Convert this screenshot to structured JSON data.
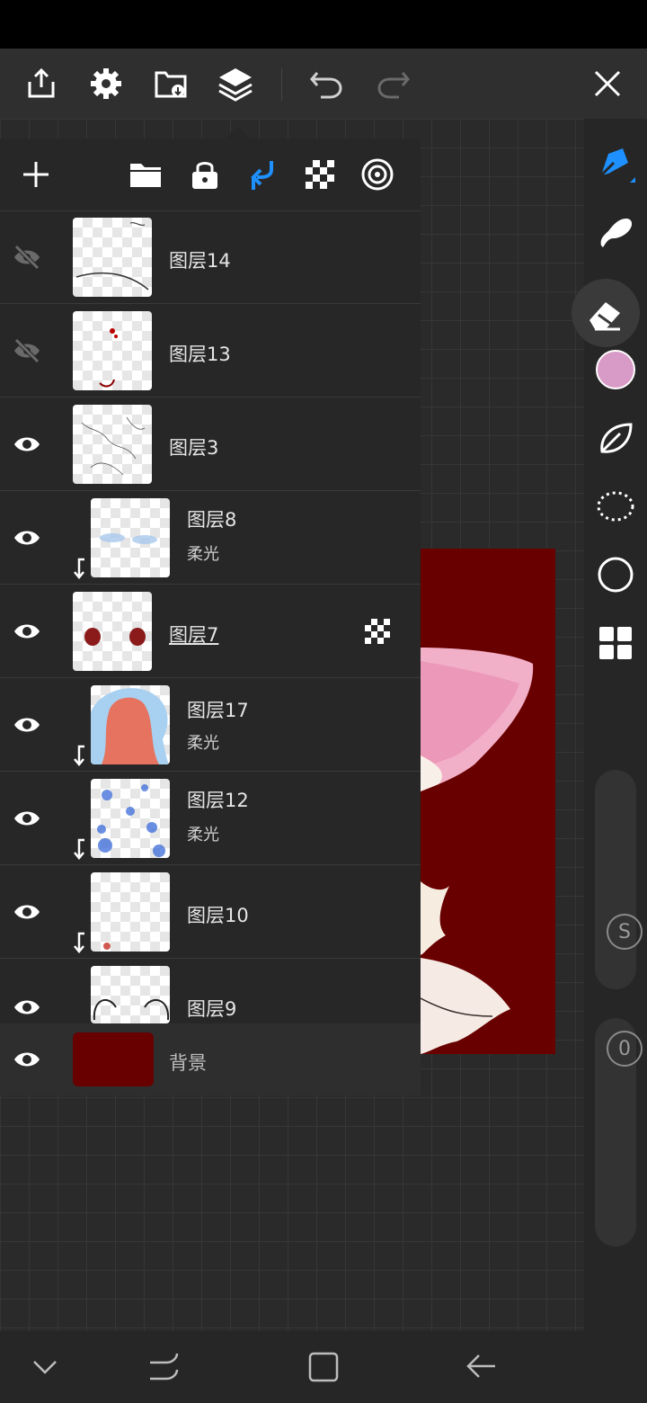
{
  "app": {
    "toolbar": {
      "icons": [
        "share-icon",
        "settings-icon",
        "import-icon",
        "layers-icon",
        "undo-icon",
        "redo-icon",
        "close-icon"
      ]
    },
    "layers_toolbar": {
      "icons": [
        "add-icon",
        "folder-icon",
        "lock-icon",
        "clip-icon",
        "alpha-icon",
        "blend-icon"
      ]
    },
    "layers": [
      {
        "name": "图层14",
        "visible": false,
        "clipped": false,
        "blend": ""
      },
      {
        "name": "图层13",
        "visible": false,
        "clipped": false,
        "blend": ""
      },
      {
        "name": "图层3",
        "visible": true,
        "clipped": false,
        "blend": ""
      },
      {
        "name": "图层8",
        "visible": true,
        "clipped": true,
        "blend": "柔光"
      },
      {
        "name": "图层7",
        "visible": true,
        "clipped": false,
        "blend": "",
        "selected": true,
        "alpha_lock": true
      },
      {
        "name": "图层17",
        "visible": true,
        "clipped": true,
        "blend": "柔光"
      },
      {
        "name": "图层12",
        "visible": true,
        "clipped": true,
        "blend": "柔光"
      },
      {
        "name": "图层10",
        "visible": true,
        "clipped": true,
        "blend": ""
      },
      {
        "name": "图层9",
        "visible": true,
        "clipped": false,
        "blend": ""
      }
    ],
    "background_layer": {
      "name": "背景",
      "visible": true,
      "color": "#690000"
    },
    "right_tools": {
      "icons": [
        "pen-icon",
        "smudge-icon",
        "eraser-icon",
        "color-swatch",
        "leaf-icon",
        "lasso-icon",
        "circle-icon",
        "grid-icon"
      ],
      "current_color": "#d89ac6",
      "size_label": "S",
      "opacity_label": "0"
    },
    "colors": {
      "accent": "#1e90ff",
      "background_layer": "#690000"
    }
  }
}
